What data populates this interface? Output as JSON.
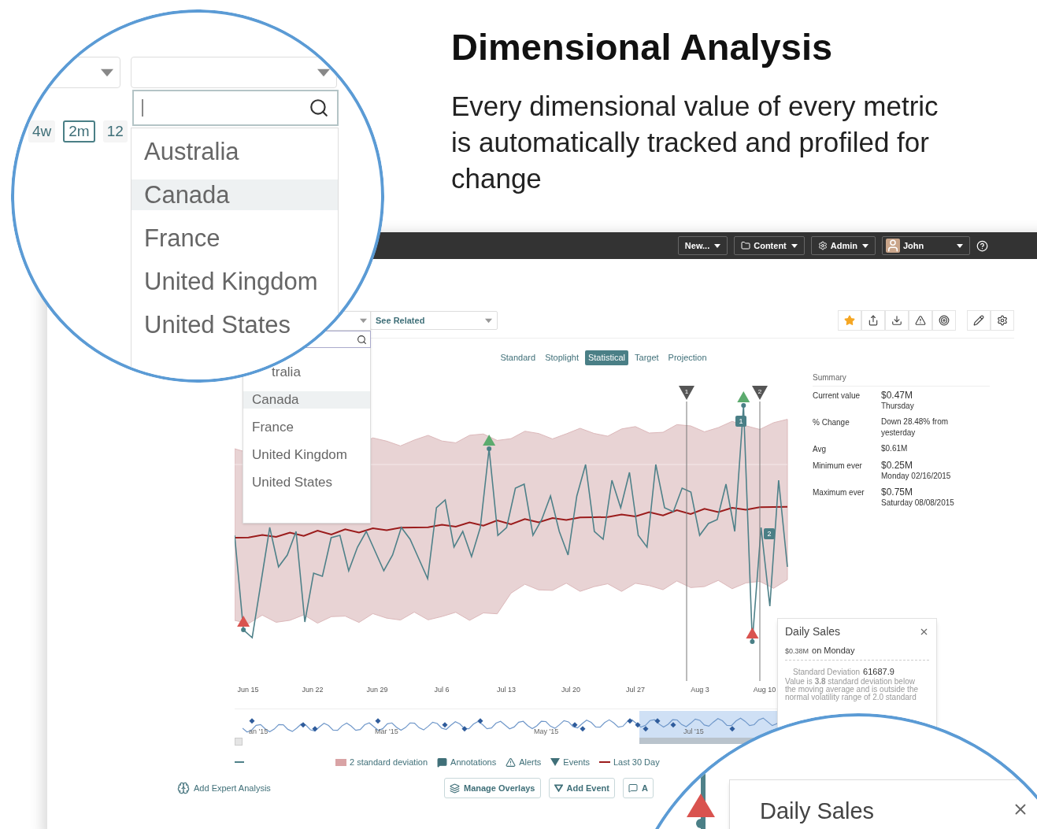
{
  "heading": {
    "title": "Dimensional Analysis",
    "description": "Every dimensional value of every metric is automatically tracked and profiled for change"
  },
  "app": {
    "top_bar": {
      "menus": [
        {
          "label": "New...",
          "kind": "plain"
        },
        {
          "label": "Content",
          "kind": "folder"
        },
        {
          "label": "Admin",
          "kind": "gear"
        },
        {
          "label": "John",
          "kind": "user"
        }
      ]
    },
    "country_filter": {
      "options": [
        {
          "label": "tralia",
          "selected": false
        },
        {
          "label": "Canada",
          "selected": true
        },
        {
          "label": "France",
          "selected": false
        },
        {
          "label": "United Kingdom",
          "selected": false
        },
        {
          "label": "United States",
          "selected": false
        }
      ]
    },
    "related_dropdown": {
      "label": "See Related"
    },
    "toolbar": [
      {
        "kind": "star"
      },
      {
        "kind": "share"
      },
      {
        "kind": "download"
      },
      {
        "kind": "alert"
      },
      {
        "kind": "target"
      },
      {
        "kind": "edit"
      },
      {
        "kind": "settings"
      }
    ],
    "view_tabs": [
      {
        "label": "Standard",
        "selected": false
      },
      {
        "label": "Stoplight",
        "selected": false
      },
      {
        "label": "Statistical",
        "selected": true
      },
      {
        "label": "Target",
        "selected": false
      },
      {
        "label": "Projection",
        "selected": false
      }
    ],
    "chart": {
      "x_labels": [
        "Jun 15",
        "Jun 22",
        "Jun 29",
        "Jul 6",
        "Jul 13",
        "Jul 20",
        "Jul 27",
        "Aug 3",
        "Aug 10"
      ],
      "event_markers": [
        "1",
        "2"
      ],
      "annotation_markers": [
        "1",
        "2"
      ]
    },
    "navigator": {
      "labels": [
        "an '15",
        "Mar '15",
        "May '15",
        "Jul '15"
      ]
    },
    "legend": [
      {
        "label": "2 standard deviation",
        "kind": "band"
      },
      {
        "label": "Annotations",
        "kind": "annotation"
      },
      {
        "label": "Alerts",
        "kind": "alert"
      },
      {
        "label": "Events",
        "kind": "event"
      },
      {
        "label": "Last 30 Day",
        "kind": "line"
      }
    ],
    "summary": {
      "title": "Summary",
      "rows": [
        {
          "label": "Current value",
          "value": "$0.47M",
          "detail": "Thursday"
        },
        {
          "label": "% Change",
          "value": "Down 28.48% from yesterday"
        },
        {
          "label": "Avg",
          "value": "$0.61M"
        },
        {
          "label": "Minimum ever",
          "value": "$0.25M",
          "detail": "Monday 02/16/2015"
        },
        {
          "label": "Maximum ever",
          "value": "$0.75M",
          "detail": "Saturday 08/08/2015"
        }
      ]
    },
    "tooltip": {
      "title": "Daily Sales",
      "value": "$0.38M",
      "day": "on Monday",
      "stat_label": "Standard Deviation",
      "stat_value": "61687.9",
      "text": "Value is **3.8** standard deviation below the moving average and is outside the normal volatility range of 2.0 standard"
    },
    "footer": {
      "expert_link": "Add Expert Analysis",
      "buttons": [
        {
          "label": "Manage Overlays",
          "kind": "layers"
        },
        {
          "label": "Add Event",
          "kind": "event"
        },
        {
          "label": "A",
          "kind": "annotation"
        }
      ]
    }
  },
  "magnifier_dropdown": {
    "time_buttons": [
      {
        "label": "4w",
        "selected": false
      },
      {
        "label": "2m",
        "selected": true
      },
      {
        "label": "12",
        "selected": false
      }
    ],
    "options": [
      {
        "label": "Australia",
        "selected": false
      },
      {
        "label": "Canada",
        "selected": true
      },
      {
        "label": "France",
        "selected": false
      },
      {
        "label": "United Kingdom",
        "selected": false
      },
      {
        "label": "United States",
        "selected": false
      }
    ]
  },
  "magnifier_tooltip": {
    "title": "Daily Sales"
  }
}
